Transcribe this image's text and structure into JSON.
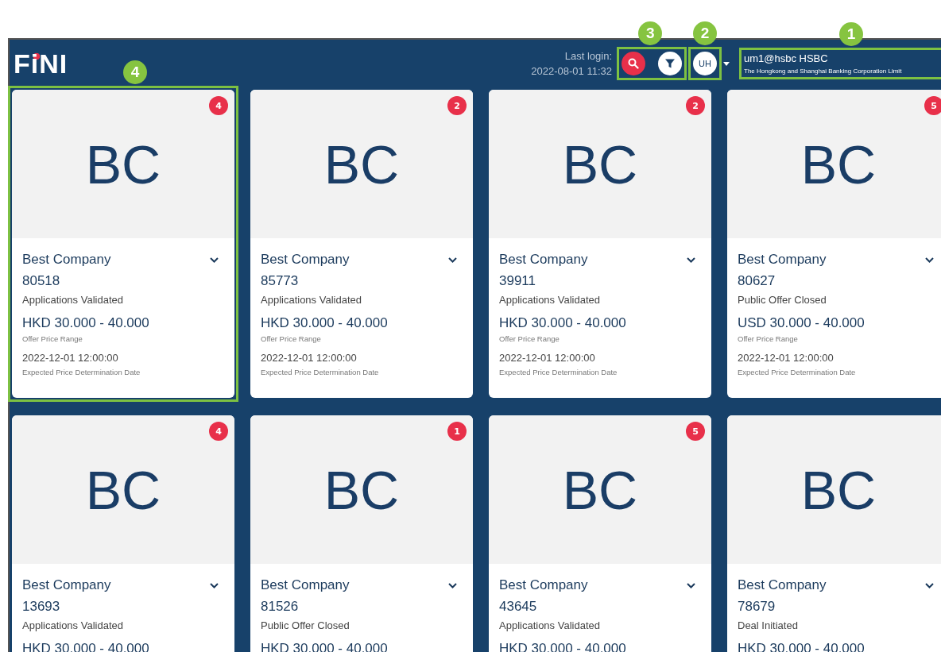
{
  "header": {
    "logo": "FiNI",
    "last_login_label": "Last login:",
    "last_login_time": "2022-08-01 11:32",
    "tools": {
      "callout": "3"
    },
    "avatar": {
      "initials": "UH",
      "callout": "2"
    },
    "account": {
      "user": "um1@hsbc HSBC",
      "organization": "The Hongkong and Shanghai Banking Corporation Limit",
      "callout": "1"
    }
  },
  "cards": [
    {
      "logo": "BC",
      "badge": "4",
      "company": "Best Company",
      "id": "80518",
      "status": "Applications Validated",
      "price": "HKD 30.000 - 40.000",
      "price_label": "Offer Price Range",
      "date": "2022-12-01 12:00:00",
      "date_label": "Expected Price Determination Date",
      "callout": "4"
    },
    {
      "logo": "BC",
      "badge": "2",
      "company": "Best Company",
      "id": "85773",
      "status": "Applications Validated",
      "price": "HKD 30.000 - 40.000",
      "price_label": "Offer Price Range",
      "date": "2022-12-01 12:00:00",
      "date_label": "Expected Price Determination Date"
    },
    {
      "logo": "BC",
      "badge": "2",
      "company": "Best Company",
      "id": "39911",
      "status": "Applications Validated",
      "price": "HKD 30.000 - 40.000",
      "price_label": "Offer Price Range",
      "date": "2022-12-01 12:00:00",
      "date_label": "Expected Price Determination Date"
    },
    {
      "logo": "BC",
      "badge": "5",
      "company": "Best Company",
      "id": "80627",
      "status": "Public Offer Closed",
      "price": "USD 30.000 - 40.000",
      "price_label": "Offer Price Range",
      "date": "2022-12-01 12:00:00",
      "date_label": "Expected Price Determination Date"
    },
    {
      "logo": "BC",
      "badge": "4",
      "company": "Best Company",
      "id": "13693",
      "status": "Applications Validated",
      "price": "HKD 30.000 - 40.000"
    },
    {
      "logo": "BC",
      "badge": "1",
      "company": "Best Company",
      "id": "81526",
      "status": "Public Offer Closed",
      "price": "HKD 30.000 - 40.000"
    },
    {
      "logo": "BC",
      "badge": "5",
      "company": "Best Company",
      "id": "43645",
      "status": "Applications Validated",
      "price": "HKD 30.000 - 40.000"
    },
    {
      "logo": "BC",
      "company": "Best Company",
      "id": "78679",
      "status": "Deal Initiated",
      "price": "HKD 30.000 - 40.000"
    }
  ]
}
